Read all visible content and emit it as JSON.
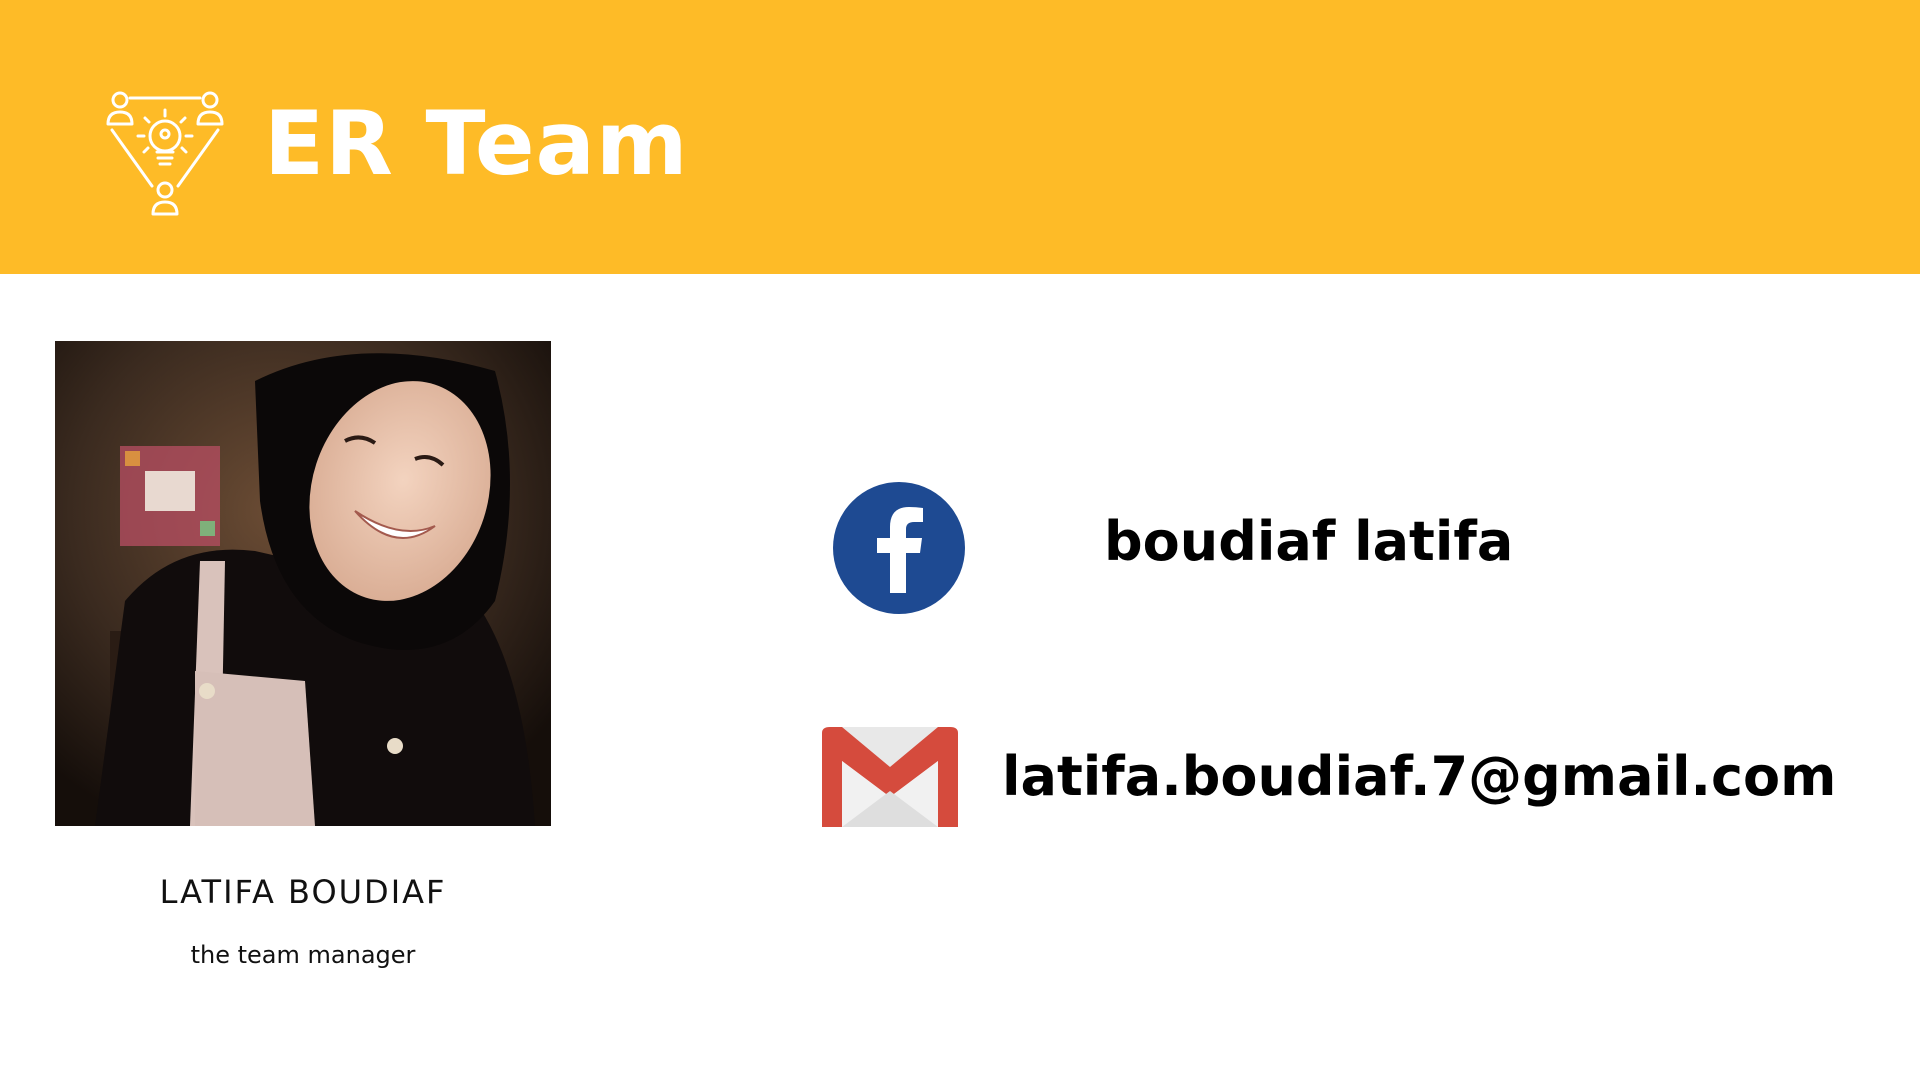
{
  "header": {
    "title": "ER Team",
    "background_color": "#FEBB27",
    "logo_icon": "lightbulb-team-icon"
  },
  "profile": {
    "photo_icon": "profile-photo",
    "name": "LATIFA BOUDIAF",
    "role": "the team manager"
  },
  "contacts": {
    "facebook": {
      "icon": "facebook-icon",
      "icon_color": "#1E4A92",
      "label": "boudiaf latifa"
    },
    "email": {
      "icon": "gmail-icon",
      "icon_color": "#D54B3D",
      "label": "latifa.boudiaf.7@gmail.com"
    }
  }
}
